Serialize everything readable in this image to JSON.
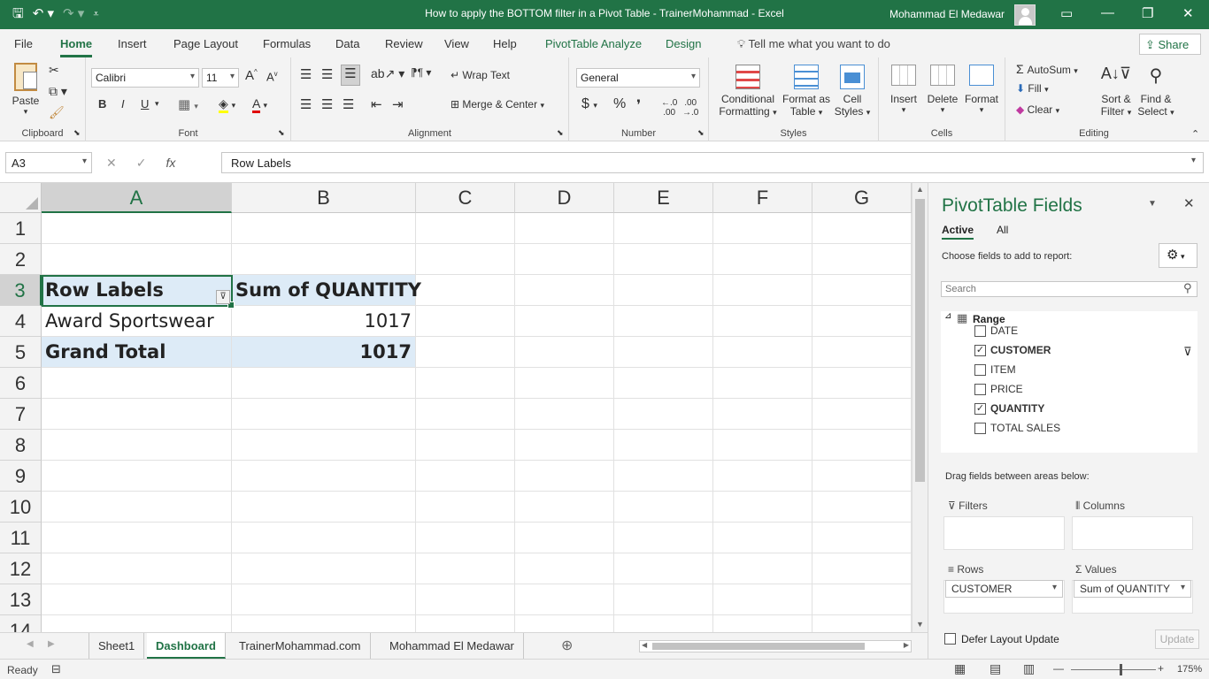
{
  "window": {
    "title": "How to apply the BOTTOM filter in a Pivot Table - TrainerMohammad  -  Excel",
    "user": "Mohammad El Medawar"
  },
  "tabs": [
    "File",
    "Home",
    "Insert",
    "Page Layout",
    "Formulas",
    "Data",
    "Review",
    "View",
    "Help",
    "PivotTable Analyze",
    "Design"
  ],
  "active_tab": "Home",
  "tell_me": "Tell me what you want to do",
  "share": "Share",
  "ribbon": {
    "clipboard": {
      "label": "Clipboard",
      "paste": "Paste"
    },
    "font": {
      "label": "Font",
      "name": "Calibri",
      "size": "11",
      "bold": "B",
      "italic": "I",
      "underline": "U"
    },
    "alignment": {
      "label": "Alignment",
      "wrap": "Wrap Text",
      "merge": "Merge & Center"
    },
    "number": {
      "label": "Number",
      "format": "General"
    },
    "styles": {
      "label": "Styles",
      "conditional": "Conditional",
      "conditional2": "Formatting",
      "format_as": "Format as",
      "format_as2": "Table",
      "cell": "Cell",
      "cell2": "Styles"
    },
    "cells": {
      "label": "Cells",
      "insert": "Insert",
      "delete": "Delete",
      "format": "Format"
    },
    "editing": {
      "label": "Editing",
      "autosum": "AutoSum",
      "fill": "Fill",
      "clear": "Clear",
      "sort": "Sort &",
      "sort2": "Filter",
      "find": "Find &",
      "find2": "Select"
    }
  },
  "formula_bar": {
    "name_box": "A3",
    "formula": "Row Labels"
  },
  "columns": [
    "A",
    "B",
    "C",
    "D",
    "E",
    "F",
    "G"
  ],
  "rows": [
    "1",
    "2",
    "3",
    "4",
    "5",
    "6",
    "7",
    "8",
    "9",
    "10",
    "11",
    "12",
    "13",
    "14"
  ],
  "pivot": {
    "row_labels": "Row Labels",
    "sum_header": "Sum of QUANTITY",
    "item": "Award Sportswear",
    "item_value": "1017",
    "grand_total": "Grand Total",
    "grand_value": "1017"
  },
  "sheets": [
    "Sheet1",
    "Dashboard",
    "TrainerMohammad.com",
    "Mohammad El Medawar"
  ],
  "active_sheet": "Dashboard",
  "status": {
    "ready": "Ready",
    "zoom": "175%"
  },
  "pane": {
    "title": "PivotTable Fields",
    "tab_active": "Active",
    "tab_all": "All",
    "choose": "Choose fields to add to report:",
    "search_placeholder": "Search",
    "range": "Range",
    "fields": [
      {
        "name": "DATE",
        "checked": false
      },
      {
        "name": "CUSTOMER",
        "checked": true
      },
      {
        "name": "ITEM",
        "checked": false
      },
      {
        "name": "PRICE",
        "checked": false
      },
      {
        "name": "QUANTITY",
        "checked": true
      },
      {
        "name": "TOTAL SALES",
        "checked": false
      }
    ],
    "drag": "Drag fields between areas below:",
    "filters": "Filters",
    "columns": "Columns",
    "rows": "Rows",
    "values": "Values",
    "rows_chip": "CUSTOMER",
    "values_chip": "Sum of QUANTITY",
    "defer": "Defer Layout Update",
    "update": "Update"
  }
}
